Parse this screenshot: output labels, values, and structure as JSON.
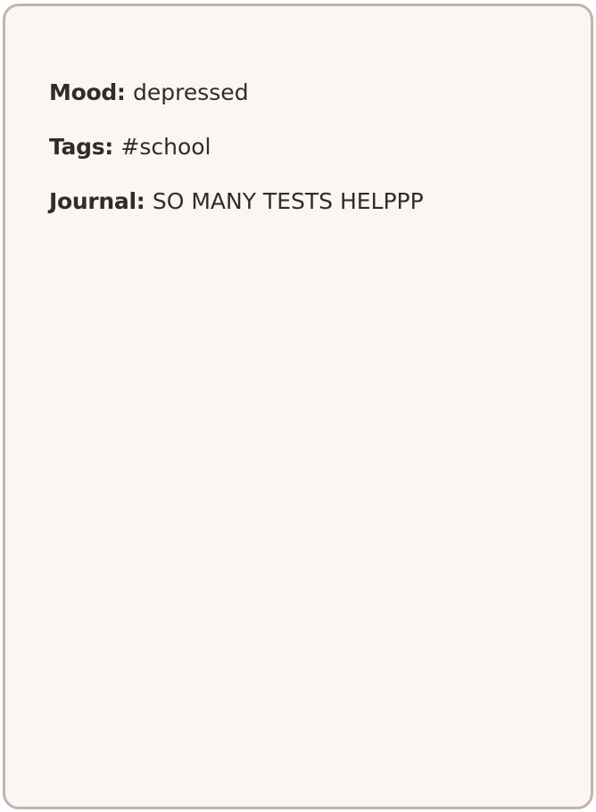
{
  "entry": {
    "mood": {
      "label": "Mood:",
      "value": "depressed"
    },
    "tags": {
      "label": "Tags:",
      "value": "#school"
    },
    "journal": {
      "label": "Journal:",
      "value": "SO MANY TESTS HELPPP"
    }
  },
  "colors": {
    "card_background": "#fbf6f1",
    "card_border": "#c4b2b2",
    "text": "#2f2c2c"
  }
}
